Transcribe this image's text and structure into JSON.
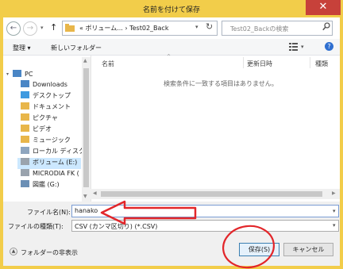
{
  "window": {
    "title": "名前を付けて保存",
    "close_glyph": "✕"
  },
  "nav": {
    "back_glyph": "←",
    "forward_glyph": "→",
    "up_glyph": "↑",
    "address_path": "« ボリューム... › Test02_Back",
    "refresh_glyph": "↻",
    "search_placeholder": "Test02_Backの検索"
  },
  "toolbar": {
    "organize_label": "整理 ▾",
    "new_folder_label": "新しいフォルダー",
    "help_glyph": "?"
  },
  "tree": {
    "items": [
      {
        "label": "PC",
        "icon": "pc-icon"
      },
      {
        "label": "Downloads",
        "icon": "downloads-folder-icon"
      },
      {
        "label": "デスクトップ",
        "icon": "desktop-folder-icon"
      },
      {
        "label": "ドキュメント",
        "icon": "documents-folder-icon"
      },
      {
        "label": "ピクチャ",
        "icon": "pictures-folder-icon"
      },
      {
        "label": "ビデオ",
        "icon": "videos-folder-icon"
      },
      {
        "label": "ミュージック",
        "icon": "music-folder-icon"
      },
      {
        "label": "ローカル ディスク (C",
        "icon": "local-disk-icon"
      },
      {
        "label": "ボリューム (E:)",
        "icon": "volume-drive-icon"
      },
      {
        "label": "MICRODIA FK (",
        "icon": "usb-drive-icon"
      },
      {
        "label": "図鑑 (G:)",
        "icon": "drive-icon"
      }
    ]
  },
  "list": {
    "columns": [
      "名前",
      "更新日時",
      "種類"
    ],
    "empty_message": "検索条件に一致する項目はありません。"
  },
  "form": {
    "filename_label": "ファイル名(N):",
    "filename_value": "hanako",
    "filetype_label": "ファイルの種類(T):",
    "filetype_value": "CSV (カンマ区切り) (*.CSV)",
    "hide_folders_label": "フォルダーの非表示"
  },
  "buttons": {
    "save_label": "保存(S)",
    "cancel_label": "キャンセル"
  },
  "colors": {
    "frame": "#f2cd4a",
    "close": "#c7413a",
    "annotation": "#e2262a"
  }
}
